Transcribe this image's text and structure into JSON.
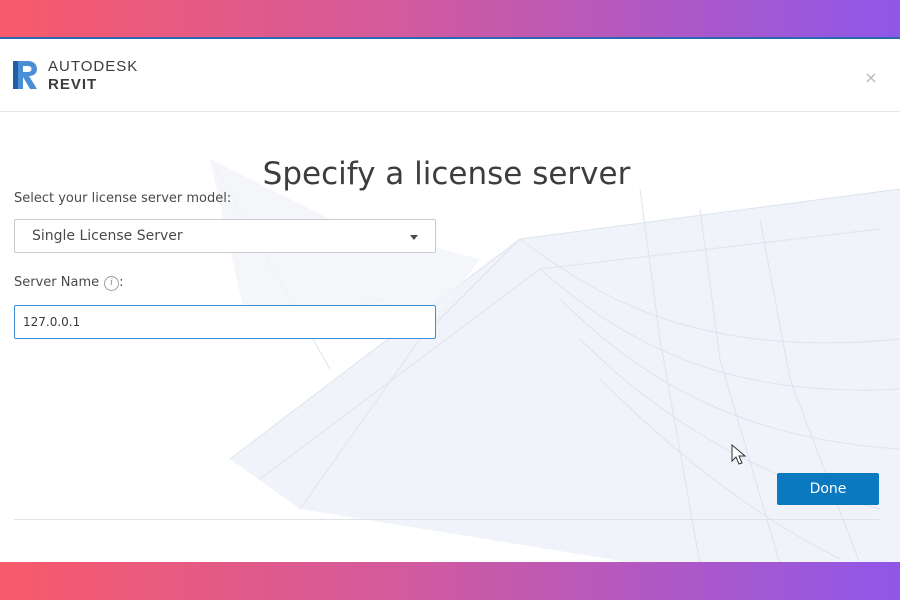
{
  "brand": {
    "company": "AUTODESK",
    "product": "REVIT",
    "logo_icon": "revit-r-logo",
    "accent_color": "#2d67b4"
  },
  "window": {
    "close_icon": "close-icon",
    "close_glyph": "×"
  },
  "main": {
    "title": "Specify a license server",
    "model_label": "Select your license server model:",
    "model_selected": "Single License Server",
    "server_label": "Server Name",
    "server_label_suffix": ":",
    "info_glyph": "i",
    "server_value": "127.0.0.1"
  },
  "footer": {
    "done_label": "Done",
    "done_color": "#0a79bf"
  }
}
